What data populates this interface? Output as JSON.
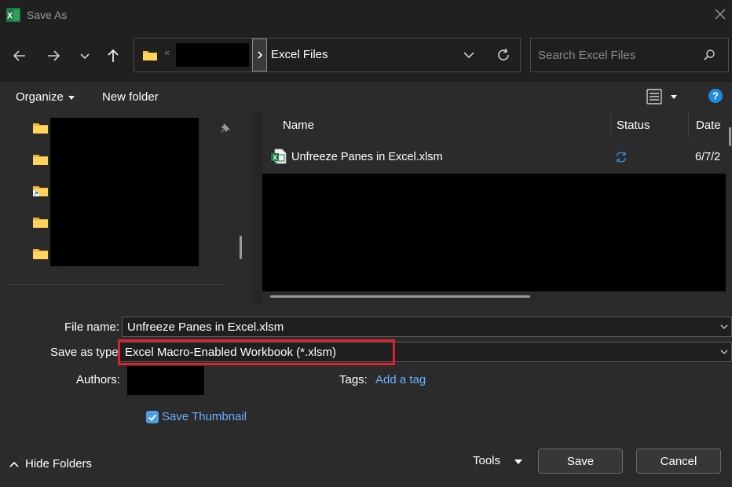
{
  "window": {
    "title": "Save As"
  },
  "nav": {
    "breadcrumb_overflow": "«",
    "current_folder": "Excel Files",
    "search_placeholder": "Search Excel Files"
  },
  "toolbar": {
    "organize_label": "Organize",
    "new_folder_label": "New folder"
  },
  "file_list": {
    "columns": [
      "Name",
      "Status",
      "Date"
    ],
    "rows": [
      {
        "name": "Unfreeze Panes in Excel.xlsm",
        "status": "sync-icon",
        "date": "6/7/2"
      }
    ]
  },
  "form": {
    "file_name_label": "File name:",
    "file_name_value": "Unfreeze Panes in Excel.xlsm",
    "save_type_label": "Save as type:",
    "save_type_value": "Excel Macro-Enabled Workbook (*.xlsm)",
    "authors_label": "Authors:",
    "tags_label": "Tags:",
    "tags_link": "Add a tag",
    "save_thumbnail_label": "Save Thumbnail",
    "save_thumbnail_checked": true
  },
  "footer": {
    "hide_folders_label": "Hide Folders",
    "tools_label": "Tools",
    "save_label": "Save",
    "cancel_label": "Cancel"
  },
  "colors": {
    "background": "#202020",
    "pane": "#2b2b2b",
    "link": "#6cb0ff",
    "highlight": "#e0202a",
    "folder": "#f5c542",
    "excel_green": "#1e7a45"
  }
}
